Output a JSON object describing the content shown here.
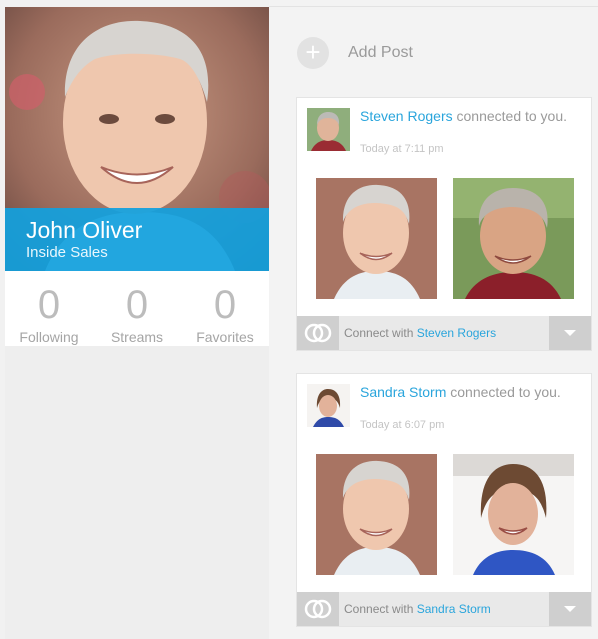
{
  "profile": {
    "name": "John Oliver",
    "role": "Inside Sales",
    "stats": [
      {
        "value": "0",
        "label": "Following"
      },
      {
        "value": "0",
        "label": "Streams"
      },
      {
        "value": "0",
        "label": "Favorites"
      }
    ]
  },
  "add_post": {
    "label": "Add Post",
    "icon": "plus-icon"
  },
  "feed": [
    {
      "person": "Steven Rogers",
      "action": " connected to you.",
      "time": "Today at 7:11 pm",
      "connect_prefix": "Connect with ",
      "connect_name": "Steven Rogers"
    },
    {
      "person": "Sandra Storm",
      "action": " connected to you.",
      "time": "Today at 6:07 pm",
      "connect_prefix": "Connect with ",
      "connect_name": "Sandra Storm"
    }
  ],
  "colors": {
    "accent": "#2aa5dc",
    "band": "#12a0de"
  }
}
